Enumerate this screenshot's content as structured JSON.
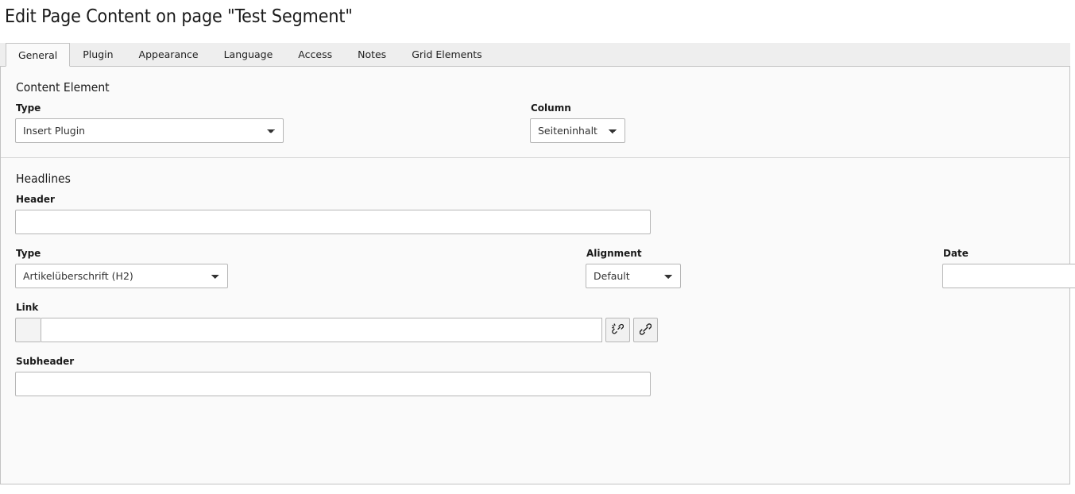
{
  "page": {
    "title": "Edit Page Content on page \"Test Segment\""
  },
  "tabs": [
    {
      "label": "General",
      "active": true
    },
    {
      "label": "Plugin",
      "active": false
    },
    {
      "label": "Appearance",
      "active": false
    },
    {
      "label": "Language",
      "active": false
    },
    {
      "label": "Access",
      "active": false
    },
    {
      "label": "Notes",
      "active": false
    },
    {
      "label": "Grid Elements",
      "active": false
    }
  ],
  "sections": {
    "content_element": {
      "title": "Content Element",
      "type": {
        "label": "Type",
        "value": "Insert Plugin",
        "options": [
          "Insert Plugin"
        ]
      },
      "column": {
        "label": "Column",
        "value": "Seiteninhalt",
        "options": [
          "Seiteninhalt"
        ]
      }
    },
    "headlines": {
      "title": "Headlines",
      "header": {
        "label": "Header",
        "value": "",
        "placeholder": ""
      },
      "type": {
        "label": "Type",
        "value": "Artikelüberschrift (H2)",
        "options": [
          "Artikelüberschrift (H2)"
        ]
      },
      "alignment": {
        "label": "Alignment",
        "value": "Default",
        "options": [
          "Default"
        ]
      },
      "date": {
        "label": "Date",
        "value": "",
        "placeholder": "",
        "picker_icon": "calendar-icon"
      },
      "link": {
        "label": "Link",
        "value": "",
        "placeholder": "",
        "unlink_icon": "link-broken-icon",
        "browse_icon": "link-icon"
      },
      "subheader": {
        "label": "Subheader",
        "value": "",
        "placeholder": ""
      }
    }
  },
  "colors": {
    "panel_bg": "#fafafa",
    "tabbar_bg": "#eeeeee",
    "border": "#c3c3c3",
    "control_border": "#b6b6b6",
    "text": "#212121"
  }
}
